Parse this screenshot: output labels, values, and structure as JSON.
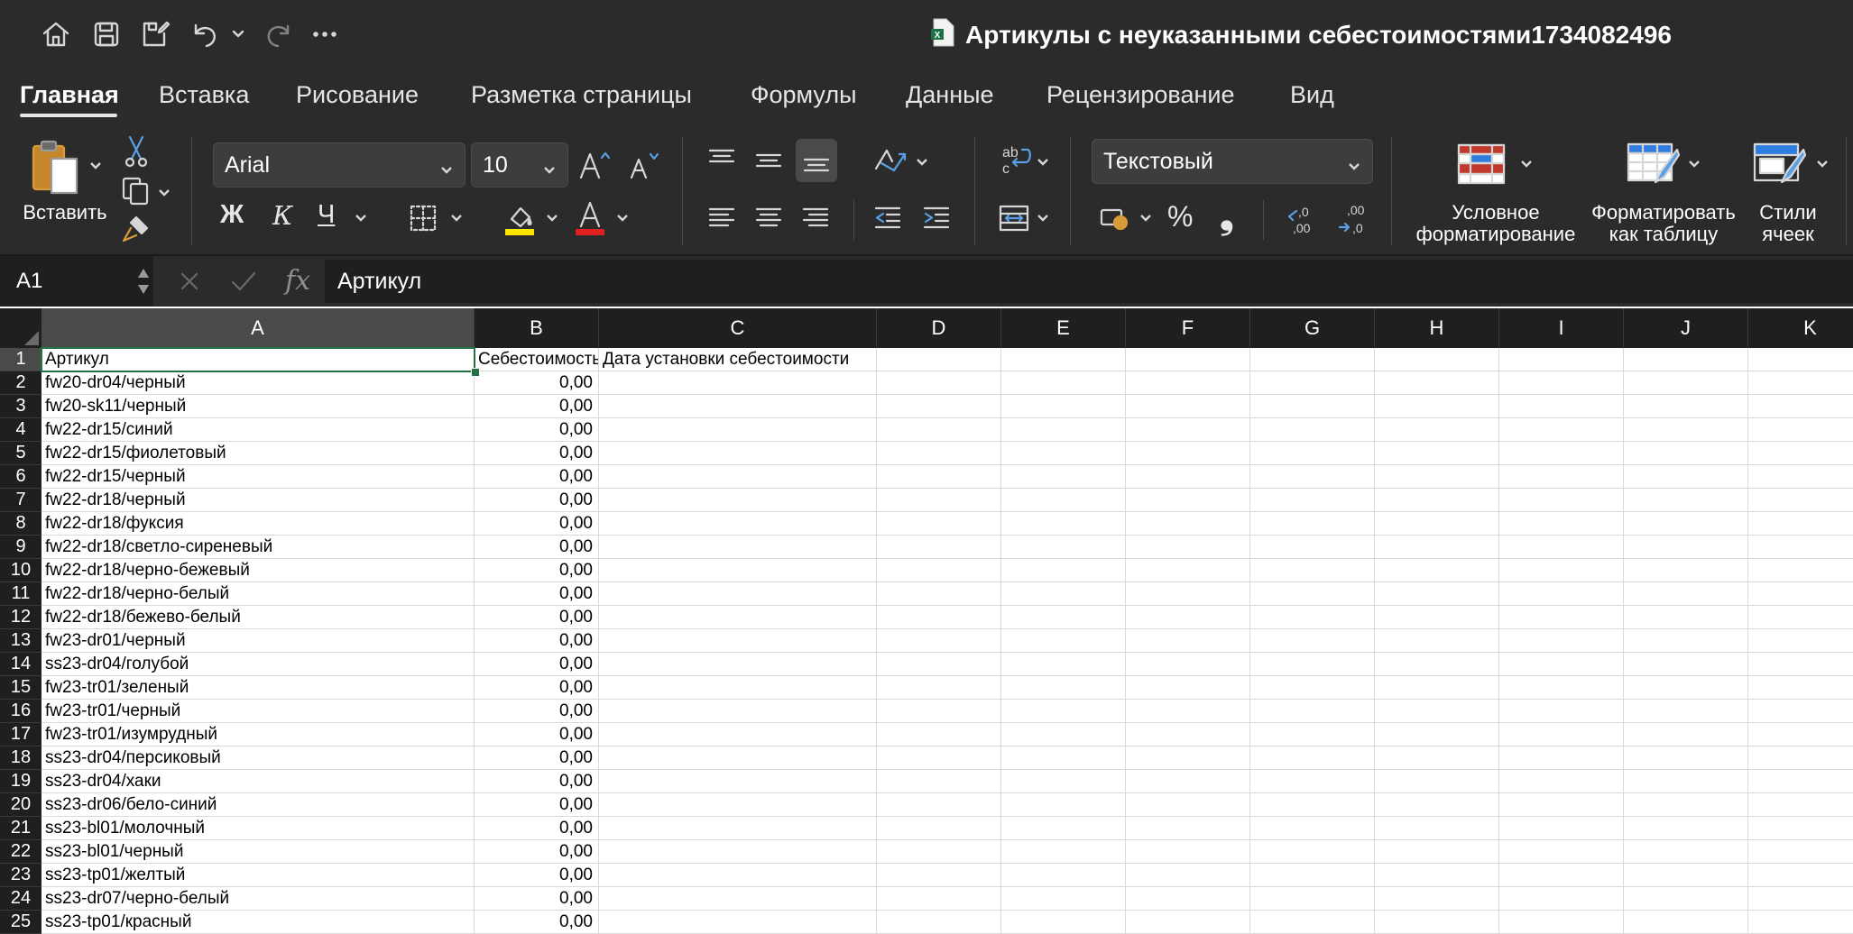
{
  "window": {
    "title": "Артикулы с неуказанными себестоимостями1734082496"
  },
  "ribbon_tabs": [
    {
      "label": "Главная",
      "active": true
    },
    {
      "label": "Вставка",
      "active": false
    },
    {
      "label": "Рисование",
      "active": false
    },
    {
      "label": "Разметка страницы",
      "active": false
    },
    {
      "label": "Формулы",
      "active": false
    },
    {
      "label": "Данные",
      "active": false
    },
    {
      "label": "Рецензирование",
      "active": false
    },
    {
      "label": "Вид",
      "active": false
    }
  ],
  "toolbar": {
    "paste_label": "Вставить",
    "font_name": "Arial",
    "font_size": "10",
    "bold": "Ж",
    "italic": "К",
    "underline": "Ч",
    "number_format": "Текстовый",
    "percent": "%",
    "comma": "❟",
    "conditional_formatting_line1": "Условное",
    "conditional_formatting_line2": "форматирование",
    "format_as_table_line1": "Форматировать",
    "format_as_table_line2": "как таблицу",
    "cell_styles_line1": "Стили",
    "cell_styles_line2": "ячеек"
  },
  "formula_bar": {
    "cell_reference": "A1",
    "fx": "fx",
    "content": "Артикул"
  },
  "sheet": {
    "columns": [
      "A",
      "B",
      "C",
      "D",
      "E",
      "F",
      "G",
      "H",
      "I",
      "J",
      "K"
    ],
    "header_row": [
      "Артикул",
      "Себестоимость",
      "Дата установки себестоимости"
    ],
    "rows": [
      {
        "n": "2",
        "a": "fw20-dr04/черный",
        "b": "0,00"
      },
      {
        "n": "3",
        "a": "fw20-sk11/черный",
        "b": "0,00"
      },
      {
        "n": "4",
        "a": "fw22-dr15/синий",
        "b": "0,00"
      },
      {
        "n": "5",
        "a": "fw22-dr15/фиолетовый",
        "b": "0,00"
      },
      {
        "n": "6",
        "a": "fw22-dr15/черный",
        "b": "0,00"
      },
      {
        "n": "7",
        "a": "fw22-dr18/черный",
        "b": "0,00"
      },
      {
        "n": "8",
        "a": "fw22-dr18/фуксия",
        "b": "0,00"
      },
      {
        "n": "9",
        "a": "fw22-dr18/светло-сиреневый",
        "b": "0,00"
      },
      {
        "n": "10",
        "a": "fw22-dr18/черно-бежевый",
        "b": "0,00"
      },
      {
        "n": "11",
        "a": "fw22-dr18/черно-белый",
        "b": "0,00"
      },
      {
        "n": "12",
        "a": "fw22-dr18/бежево-белый",
        "b": "0,00"
      },
      {
        "n": "13",
        "a": "fw23-dr01/черный",
        "b": "0,00"
      },
      {
        "n": "14",
        "a": "ss23-dr04/голубой",
        "b": "0,00"
      },
      {
        "n": "15",
        "a": "fw23-tr01/зеленый",
        "b": "0,00"
      },
      {
        "n": "16",
        "a": "fw23-tr01/черный",
        "b": "0,00"
      },
      {
        "n": "17",
        "a": "fw23-tr01/изумрудный",
        "b": "0,00"
      },
      {
        "n": "18",
        "a": "ss23-dr04/персиковый",
        "b": "0,00"
      },
      {
        "n": "19",
        "a": "ss23-dr04/хаки",
        "b": "0,00"
      },
      {
        "n": "20",
        "a": "ss23-dr06/бело-синий",
        "b": "0,00"
      },
      {
        "n": "21",
        "a": "ss23-bl01/молочный",
        "b": "0,00"
      },
      {
        "n": "22",
        "a": "ss23-bl01/черный",
        "b": "0,00"
      },
      {
        "n": "23",
        "a": "ss23-tp01/желтый",
        "b": "0,00"
      },
      {
        "n": "24",
        "a": "ss23-dr07/черно-белый",
        "b": "0,00"
      },
      {
        "n": "25",
        "a": "ss23-tp01/красный",
        "b": "0,00"
      }
    ]
  },
  "colors": {
    "chrome_bg": "#2b2b2b",
    "header_bg": "#1f1f1f",
    "selection": "#217346",
    "highlight_yellow": "#ffe600",
    "font_red": "#e02020",
    "icon_blue": "#2f7de0",
    "icon_red": "#c0392b"
  }
}
